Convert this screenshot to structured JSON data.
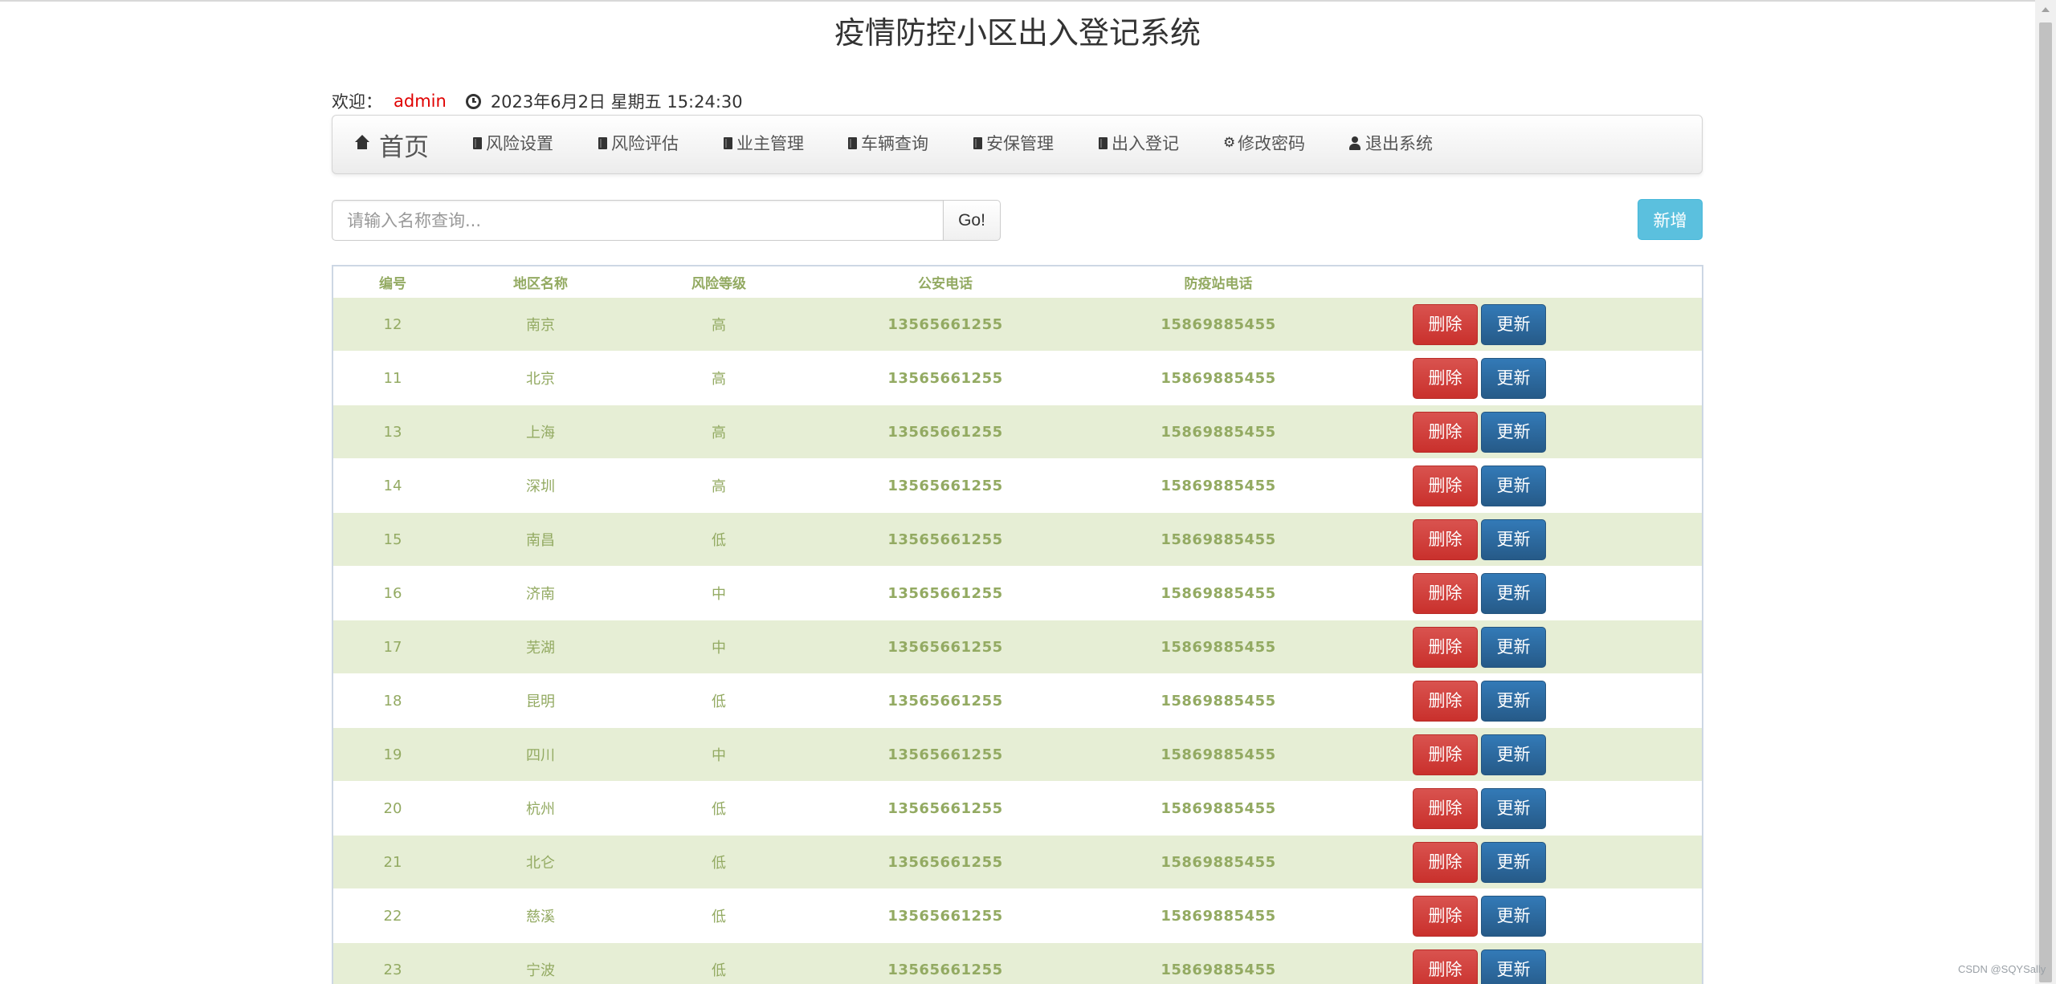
{
  "page": {
    "title": "疫情防控小区出入登记系统"
  },
  "welcome": {
    "label": "欢迎：",
    "user": "admin",
    "clock_icon": "clock-icon",
    "datetime": "2023年6月2日 星期五 15:24:30"
  },
  "nav": {
    "brand": {
      "icon": "home-icon",
      "label": "首页"
    },
    "items": [
      {
        "icon": "book-icon",
        "label": "风险设置"
      },
      {
        "icon": "book-icon",
        "label": "风险评估"
      },
      {
        "icon": "book-icon",
        "label": "业主管理"
      },
      {
        "icon": "book-icon",
        "label": "车辆查询"
      },
      {
        "icon": "book-icon",
        "label": "安保管理"
      },
      {
        "icon": "book-icon",
        "label": "出入登记"
      },
      {
        "icon": "cog-icon",
        "label": "修改密码"
      },
      {
        "icon": "user-icon",
        "label": "退出系统"
      }
    ]
  },
  "search": {
    "placeholder": "请输入名称查询...",
    "value": "",
    "go_label": "Go!"
  },
  "actions": {
    "add_label": "新增"
  },
  "table": {
    "columns": [
      "编号",
      "地区名称",
      "风险等级",
      "公安电话",
      "防疫站电话",
      ""
    ],
    "delete_label": "删除",
    "update_label": "更新",
    "rows": [
      {
        "id": "12",
        "name": "南京",
        "level": "高",
        "police": "13565661255",
        "station": "15869885455"
      },
      {
        "id": "11",
        "name": "北京",
        "level": "高",
        "police": "13565661255",
        "station": "15869885455"
      },
      {
        "id": "13",
        "name": "上海",
        "level": "高",
        "police": "13565661255",
        "station": "15869885455"
      },
      {
        "id": "14",
        "name": "深圳",
        "level": "高",
        "police": "13565661255",
        "station": "15869885455"
      },
      {
        "id": "15",
        "name": "南昌",
        "level": "低",
        "police": "13565661255",
        "station": "15869885455"
      },
      {
        "id": "16",
        "name": "济南",
        "level": "中",
        "police": "13565661255",
        "station": "15869885455"
      },
      {
        "id": "17",
        "name": "芜湖",
        "level": "中",
        "police": "13565661255",
        "station": "15869885455"
      },
      {
        "id": "18",
        "name": "昆明",
        "level": "低",
        "police": "13565661255",
        "station": "15869885455"
      },
      {
        "id": "19",
        "name": "四川",
        "level": "中",
        "police": "13565661255",
        "station": "15869885455"
      },
      {
        "id": "20",
        "name": "杭州",
        "level": "低",
        "police": "13565661255",
        "station": "15869885455"
      },
      {
        "id": "21",
        "name": "北仑",
        "level": "低",
        "police": "13565661255",
        "station": "15869885455"
      },
      {
        "id": "22",
        "name": "慈溪",
        "level": "低",
        "police": "13565661255",
        "station": "15869885455"
      },
      {
        "id": "23",
        "name": "宁波",
        "level": "低",
        "police": "13565661255",
        "station": "15869885455"
      }
    ]
  },
  "watermark": "CSDN @SQYSally",
  "colors": {
    "accent_user": "#e00000",
    "table_text": "#93aa62",
    "row_stripe": "#e6eed5",
    "delete_button": "#d9534f",
    "update_button": "#337ab7",
    "add_button": "#5bc0de"
  }
}
